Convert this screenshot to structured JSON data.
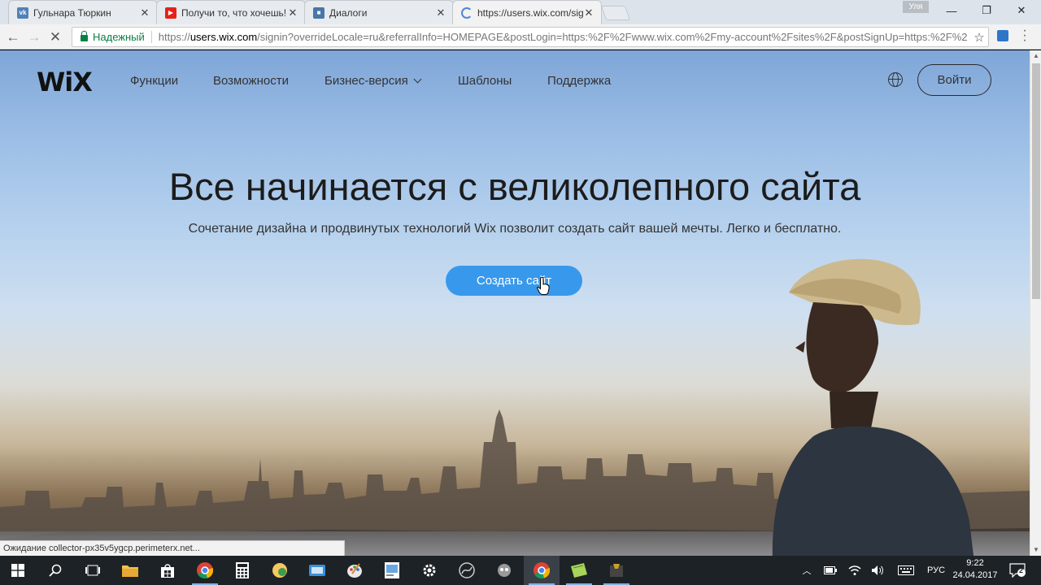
{
  "browser": {
    "tabs": [
      {
        "title": "Гульнара Тюркин",
        "favicon_color": "#5181b8",
        "favicon_glyph": "vk"
      },
      {
        "title": "Получи то, что хочешь!",
        "favicon_color": "#e62117",
        "favicon_glyph": "▶"
      },
      {
        "title": "Диалоги",
        "favicon_color": "#4a76a8",
        "favicon_glyph": "■"
      },
      {
        "title": "https://users.wix.com/sig",
        "favicon_color": "#4f87d6",
        "favicon_glyph": "◌"
      }
    ],
    "user_badge": "Уля",
    "window_controls": {
      "minimize": "—",
      "restore": "❐",
      "close": "✕"
    },
    "secure_label": "Надежный",
    "url_scheme": "https://",
    "url_host": "users.wix.com",
    "url_rest": "/signin?overrideLocale=ru&referralInfo=HOMEPAGE&postLogin=https:%2F%2Fwww.wix.com%2Fmy-account%2Fsites%2F&postSignUp=https:%2F%2",
    "status_text": "Ожидание collector-px35v5ygcp.perimeterx.net..."
  },
  "site": {
    "logo": "WiX",
    "nav": [
      "Функции",
      "Возможности",
      "Бизнес-версия",
      "Шаблоны",
      "Поддержка"
    ],
    "login_label": "Войти",
    "headline": "Все начинается с великолепного сайта",
    "subheadline": "Сочетание дизайна и продвинутых технологий Wix позволит создать сайт вашей мечты. Легко и бесплатно.",
    "cta_label": "Создать сайт"
  },
  "taskbar": {
    "apps": [
      "start-icon",
      "search-icon",
      "task-view-icon",
      "file-explorer-icon",
      "store-icon",
      "chrome-icon",
      "calculator-icon",
      "app-icon",
      "app-icon",
      "paint-icon",
      "app-icon",
      "settings-icon",
      "app-icon",
      "app-icon",
      "chrome-icon",
      "app-icon",
      "app-icon"
    ],
    "language": "РУС",
    "time": "9:22",
    "date": "24.04.2017",
    "notification_count": "2"
  },
  "colors": {
    "accent": "#3899ec",
    "secure": "#0b8043"
  }
}
